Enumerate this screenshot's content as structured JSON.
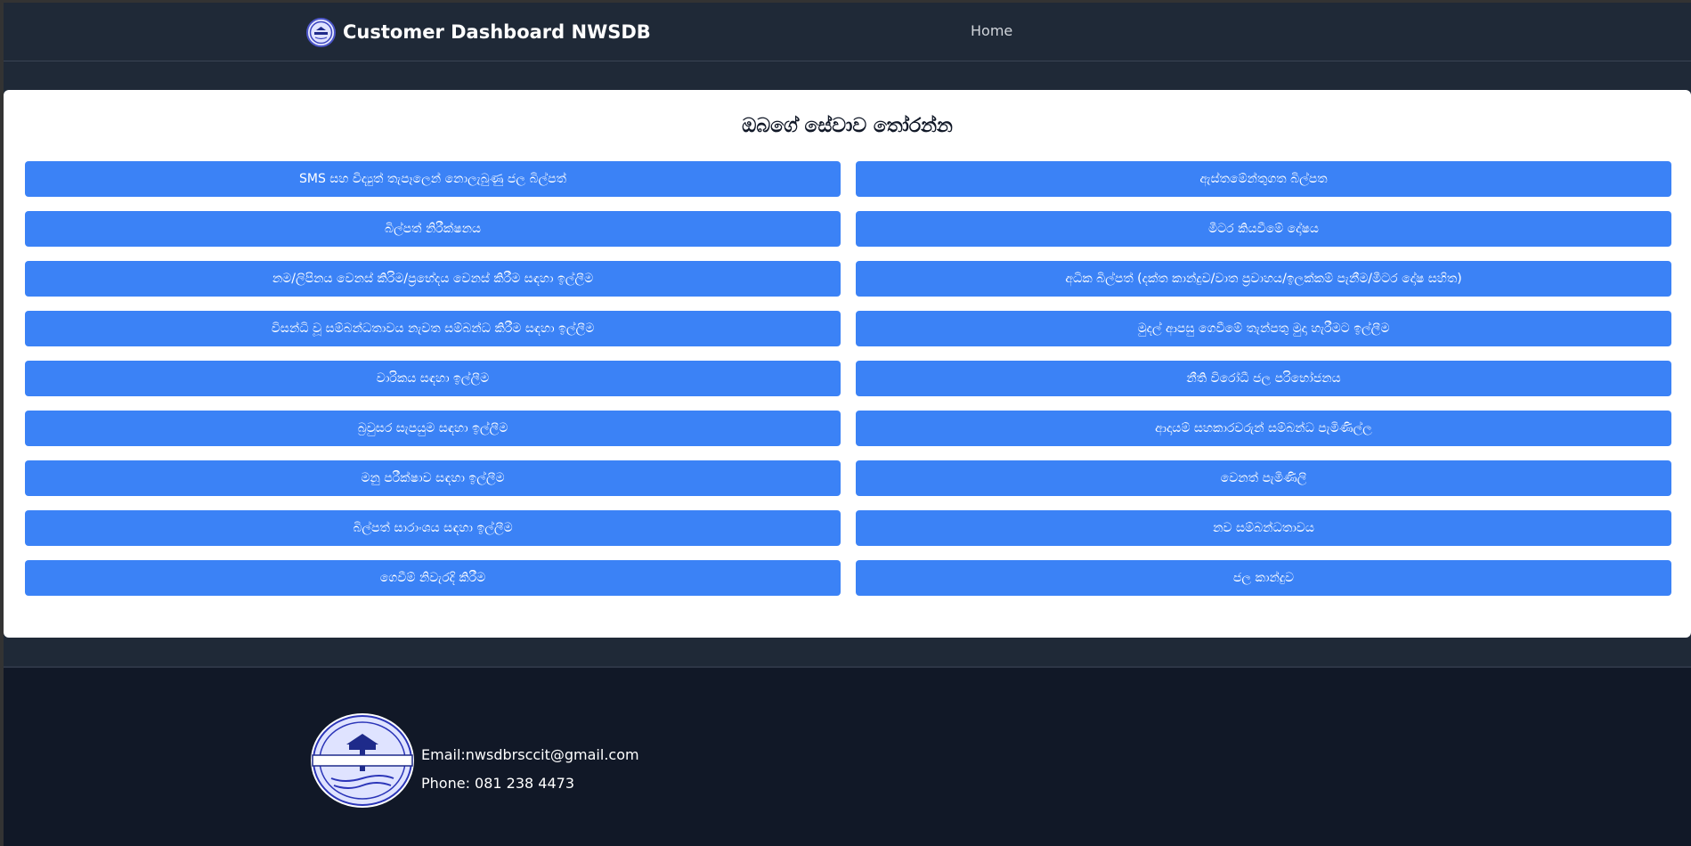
{
  "header": {
    "title": "Customer Dashboard NWSDB",
    "nav_home": "Home"
  },
  "main": {
    "heading": "ඔබගේ සේවාව තෝරන්න",
    "services_left": [
      "SMS සහ විද්‍යුත් තැපෑලෙන් නොලැබුණු ජල බිල්පත්",
      "බිල්පත් නිරීක්ෂනය",
      "නම/ලිපිනය වෙනස් කිරිම/ප්‍රභේදය වෙනස් කිරීම සඳහා ඉල්ලීම",
      "විසන්ධි වූ සම්බන්ධතාවය නැවත සම්බන්ධ කිරීම සඳහා ඉල්ලීම",
      "වාරිකය සඳහා ඉල්ලීම",
      "බ්‍රවුසර සැපයුම සඳහා ඉල්ලීම",
      "මනු පරීක්ෂාව සඳහා ඉල්ලීම",
      "බිල්පත් සාරාංශය සඳහා ඉල්ලීම",
      "ගෙවීම් නිවැරදි කිරීම"
    ],
    "services_right": [
      "ඇස්තමේන්තුගත බිල්පත",
      "මීටර කියවීමේ දෝෂය",
      "අධික බිල්පත් (දක්ත කාන්දුව/වාත ප්‍රවාහය/ඉලක්කම් පැනීම/මීටර දෝෂ සහිත)",
      "මුදල් ආපසු ගෙවීමේ තැන්පතු මුදා හැරීමට ඉල්ලීම",
      "නීති විරෝධී ජල පරිභෝජනය",
      "ආදායම් සහකාරවරුන් සම්බන්ධ පැමිණිල්ල",
      "වෙනත් පැමිණිලි",
      "නව සම්බන්ධතාවය",
      "ජල කාන්දුව"
    ]
  },
  "footer": {
    "logo_text": "National Water Supply & Drainage Board",
    "email": "Email:nwsdbrsccit@gmail.com",
    "phone": "Phone: 081 238 4473"
  },
  "colors": {
    "header_bg": "#1f2937",
    "footer_bg": "#111827",
    "button_bg": "#3b82f6",
    "card_bg": "#ffffff"
  }
}
